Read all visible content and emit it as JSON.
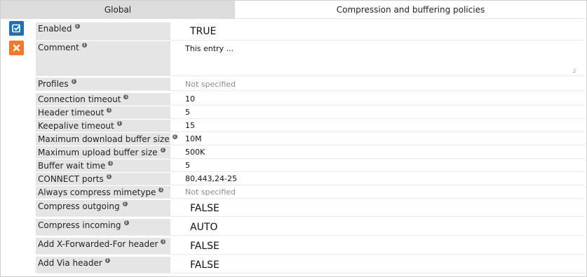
{
  "tabs": {
    "global": "Global",
    "compression": "Compression and buffering policies"
  },
  "colors": {
    "save_button": "#1f6fb6",
    "cancel_button": "#f07a2b",
    "label_background": "#e5e5e5"
  },
  "icons": {
    "save": "checkbox-check-icon",
    "cancel": "close-x-icon",
    "info": "info-icon",
    "resize": "resize-grip-icon"
  },
  "fields": {
    "enabled": {
      "label": "Enabled",
      "value": "TRUE"
    },
    "comment": {
      "label": "Comment",
      "value": "This entry ..."
    },
    "profiles": {
      "label": "Profiles",
      "value": "Not specified"
    },
    "connection_timeout": {
      "label": "Connection timeout",
      "value": "10"
    },
    "header_timeout": {
      "label": "Header timeout",
      "value": "5"
    },
    "keepalive_timeout": {
      "label": "Keepalive timeout",
      "value": "15"
    },
    "max_download_buffer": {
      "label": "Maximum download buffer size",
      "value": "10M"
    },
    "max_upload_buffer": {
      "label": "Maximum upload buffer size",
      "value": "500K"
    },
    "buffer_wait_time": {
      "label": "Buffer wait time",
      "value": "5"
    },
    "connect_ports": {
      "label": "CONNECT ports",
      "value": "80,443,24-25"
    },
    "always_compress_mimetype": {
      "label": "Always compress mimetype",
      "value": "Not specified"
    },
    "compress_outgoing": {
      "label": "Compress outgoing",
      "value": "FALSE"
    },
    "compress_incoming": {
      "label": "Compress incoming",
      "value": "AUTO"
    },
    "add_x_forwarded_for": {
      "label": "Add X-Forwarded-For header",
      "value": "FALSE"
    },
    "add_via_header": {
      "label": "Add Via header",
      "value": "FALSE"
    }
  }
}
